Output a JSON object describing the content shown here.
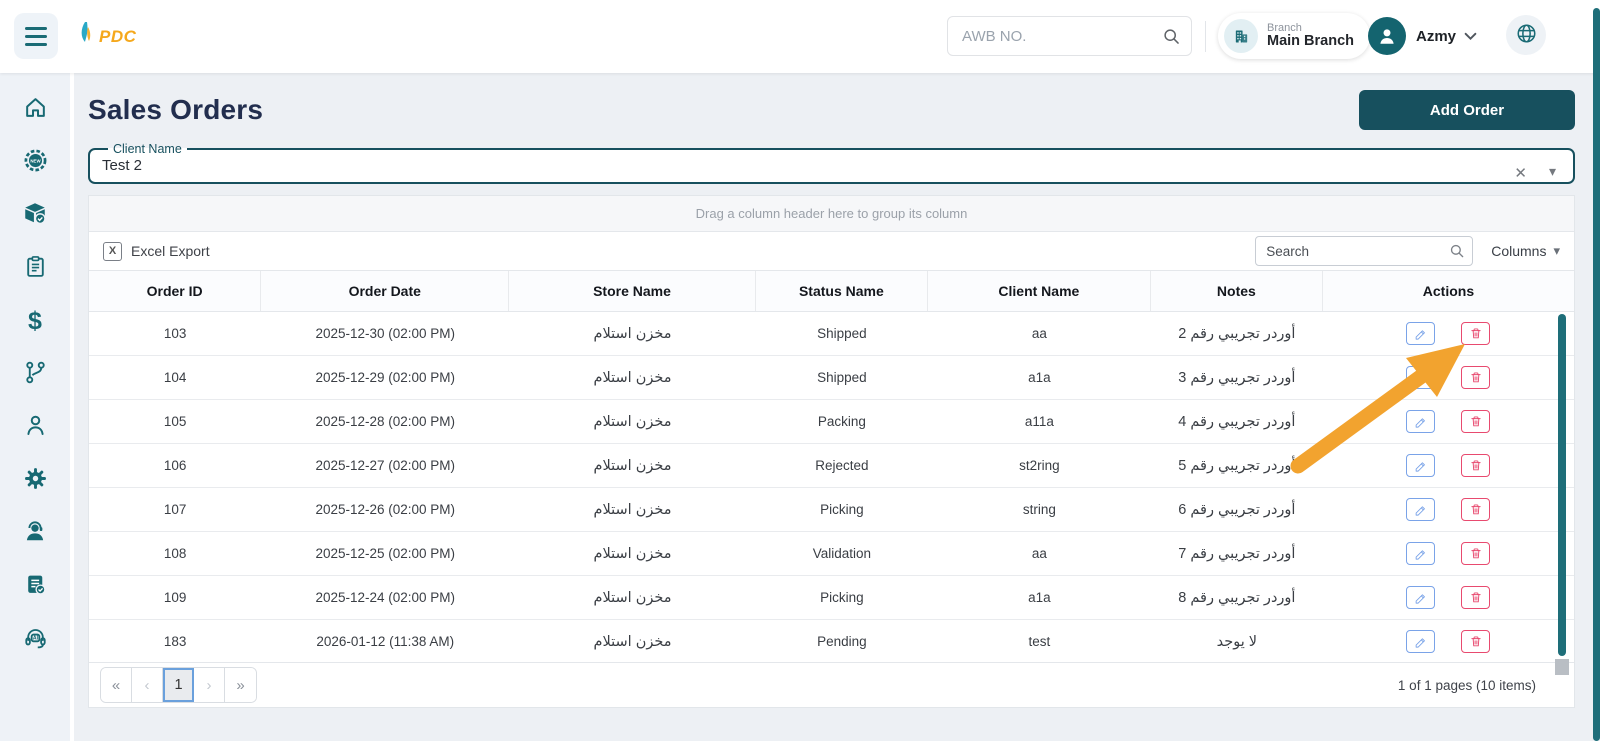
{
  "topbar": {
    "logo_text": "PDC",
    "awb_placeholder": "AWB NO.",
    "branch_label": "Branch",
    "branch_name": "Main Branch",
    "username": "Azmy"
  },
  "sidebar": {
    "icons": [
      "home-icon",
      "new-badge-icon",
      "products-box-icon",
      "orders-clipboard-icon",
      "payments-dollar-icon",
      "workflow-branch-icon",
      "clients-person-icon",
      "settings-gear-icon",
      "support-agent-icon",
      "delivery-notes-icon",
      "ai-assistant-icon"
    ]
  },
  "page": {
    "title": "Sales Orders",
    "add_order_label": "Add Order"
  },
  "filter": {
    "label": "Client Name",
    "value": "Test 2"
  },
  "grid": {
    "group_hint": "Drag a column header here to group its column",
    "excel_export_label": "Excel Export",
    "search_placeholder": "Search",
    "columns_label": "Columns",
    "headers": [
      "Order ID",
      "Order Date",
      "Store Name",
      "Status Name",
      "Client Name",
      "Notes",
      "Actions"
    ],
    "rows": [
      {
        "order_id": "103",
        "order_date": "2025-12-30 (02:00 PM)",
        "store_name": "مخزن استلام",
        "status": "Shipped",
        "client": "aa",
        "notes": "أوردر تجريبي رقم 2"
      },
      {
        "order_id": "104",
        "order_date": "2025-12-29 (02:00 PM)",
        "store_name": "مخزن استلام",
        "status": "Shipped",
        "client": "a1a",
        "notes": "أوردر تجريبي رقم 3"
      },
      {
        "order_id": "105",
        "order_date": "2025-12-28 (02:00 PM)",
        "store_name": "مخزن استلام",
        "status": "Packing",
        "client": "a11a",
        "notes": "أوردر تجريبي رقم 4"
      },
      {
        "order_id": "106",
        "order_date": "2025-12-27 (02:00 PM)",
        "store_name": "مخزن استلام",
        "status": "Rejected",
        "client": "st2ring",
        "notes": "أوردر تجريبي رقم 5"
      },
      {
        "order_id": "107",
        "order_date": "2025-12-26 (02:00 PM)",
        "store_name": "مخزن استلام",
        "status": "Picking",
        "client": "string",
        "notes": "أوردر تجريبي رقم 6"
      },
      {
        "order_id": "108",
        "order_date": "2025-12-25 (02:00 PM)",
        "store_name": "مخزن استلام",
        "status": "Validation",
        "client": "aa",
        "notes": "أوردر تجريبي رقم 7"
      },
      {
        "order_id": "109",
        "order_date": "2025-12-24 (02:00 PM)",
        "store_name": "مخزن استلام",
        "status": "Picking",
        "client": "a1a",
        "notes": "أوردر تجريبي رقم 8"
      },
      {
        "order_id": "183",
        "order_date": "2026-01-12 (11:38 AM)",
        "store_name": "مخزن استلام",
        "status": "Pending",
        "client": "test",
        "notes": "لا يوجد"
      }
    ],
    "pagination": {
      "current_page": "1",
      "summary": "1 of 1 pages (10 items)"
    }
  },
  "glyphs": {
    "clear": "✕",
    "caret_down": "▾",
    "excel_badge": "X",
    "dollar": "$",
    "ai": "AI",
    "new_badge": "NEW",
    "pager_first": "«",
    "pager_prev": "‹",
    "pager_next": "›",
    "pager_last": "»"
  },
  "colors": {
    "primary_teal": "#176973",
    "dark_teal": "#17505e",
    "title_navy": "#222e4e",
    "edit_blue": "#7aa3e8",
    "delete_red": "#e84a6f",
    "arrow_orange": "#f2a32f",
    "logo_orange": "#f5a81c"
  }
}
